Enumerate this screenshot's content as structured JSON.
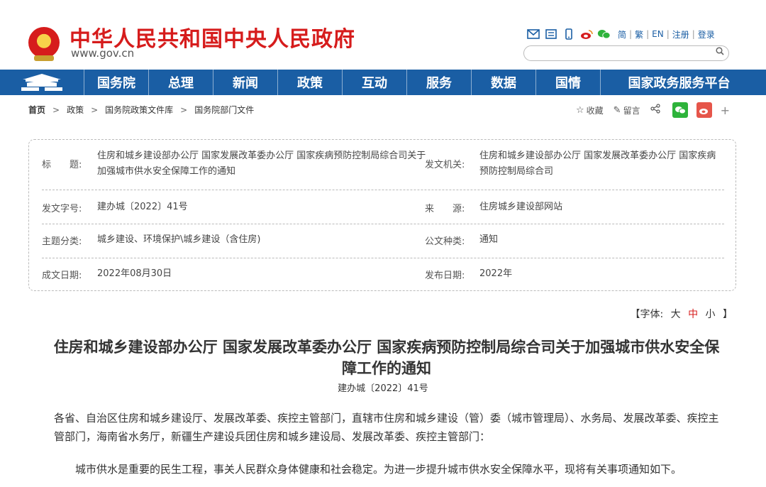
{
  "header": {
    "site_title": "中华人民共和国中央人民政府",
    "site_url": "www.gov.cn",
    "top_links": [
      "简",
      "繁",
      "EN",
      "注册",
      "登录"
    ],
    "top_icons": [
      "mail-icon",
      "news-icon",
      "mobile-icon",
      "weibo-icon",
      "wechat-icon"
    ],
    "search": {
      "placeholder": "",
      "value": ""
    }
  },
  "nav": {
    "items": [
      "国务院",
      "总理",
      "新闻",
      "政策",
      "互动",
      "服务",
      "数据",
      "国情",
      "国家政务服务平台"
    ]
  },
  "breadcrumb": [
    "首页",
    "政策",
    "国务院政策文件库",
    "国务院部门文件"
  ],
  "tools": {
    "favorite": "收藏",
    "comment": "留言",
    "plus": "+"
  },
  "info": {
    "title_label": "标　　题:",
    "title_value": "住房和城乡建设部办公厅 国家发展改革委办公厅 国家疾病预防控制局综合司关于加强城市供水安全保障工作的通知",
    "issuer_label": "发文机关:",
    "issuer_value": "住房和城乡建设部办公厅 国家发展改革委办公厅 国家疾病预防控制局综合司",
    "doc_no_label": "发文字号:",
    "doc_no_value": "建办城〔2022〕41号",
    "source_label": "来　　源:",
    "source_value": "住房城乡建设部网站",
    "topic_label": "主题分类:",
    "topic_value": "城乡建设、环境保护\\城乡建设（含住房)",
    "type_label": "公文种类:",
    "type_value": "通知",
    "date_label": "成文日期:",
    "date_value": "2022年08月30日",
    "publish_label": "发布日期:",
    "publish_value": "2022年"
  },
  "font_size": {
    "prefix": "【字体:",
    "large": "大",
    "medium": "中",
    "small": "小",
    "suffix": "】"
  },
  "article": {
    "title": "住房和城乡建设部办公厅 国家发展改革委办公厅 国家疾病预防控制局综合司关于加强城市供水安全保障工作的通知",
    "doc_no": "建办城〔2022〕41号",
    "p1": "各省、自治区住房和城乡建设厅、发展改革委、疾控主管部门，直辖市住房和城乡建设（管）委（城市管理局）、水务局、发展改革委、疾控主管部门，海南省水务厅，新疆生产建设兵团住房和城乡建设局、发展改革委、疾控主管部门：",
    "p2": "城市供水是重要的民生工程，事关人民群众身体健康和社会稳定。为进一步提升城市供水安全保障水平，现将有关事项通知如下。"
  },
  "colors": {
    "brand_red": "#d61c1c",
    "nav_blue": "#1a5ea4"
  }
}
